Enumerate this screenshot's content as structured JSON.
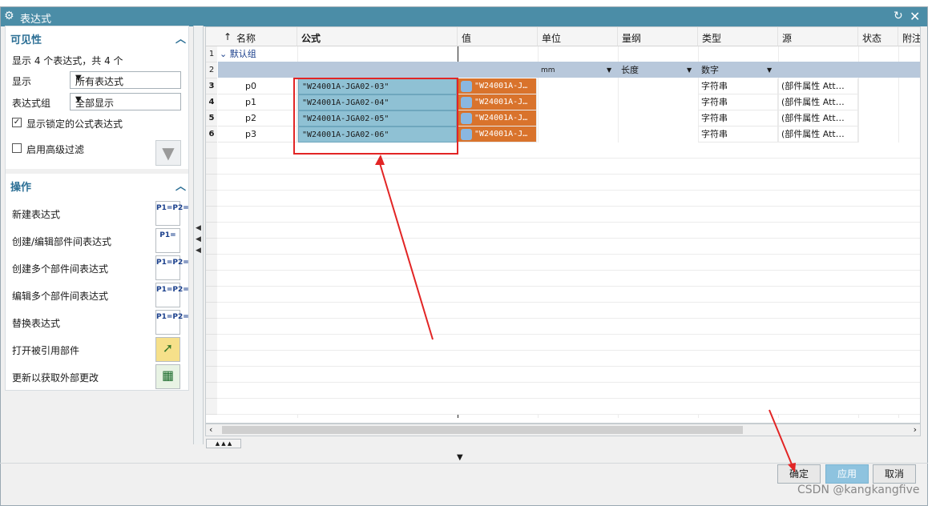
{
  "window": {
    "title": "表达式"
  },
  "visibility": {
    "header": "可见性",
    "count_text": "显示 4 个表达式，共 4 个",
    "show_label": "显示",
    "show_value": "所有表达式",
    "group_label": "表达式组",
    "group_value": "全部显示",
    "locked_checkbox": "显示锁定的公式表达式",
    "advanced_filter": "启用高级过滤"
  },
  "operations": {
    "header": "操作",
    "items": [
      {
        "label": "新建表达式",
        "icon": "new-expression-icon",
        "glyph": "P1=P2="
      },
      {
        "label": "创建/编辑部件间表达式",
        "icon": "interpart-expression-icon",
        "glyph": "P1="
      },
      {
        "label": "创建多个部件间表达式",
        "icon": "multi-interpart-icon",
        "glyph": "P1=P2="
      },
      {
        "label": "编辑多个部件间表达式",
        "icon": "edit-multi-interpart-icon",
        "glyph": "P1=P2="
      },
      {
        "label": "替换表达式",
        "icon": "replace-expression-icon",
        "glyph": "P1=P2="
      },
      {
        "label": "打开被引用部件",
        "icon": "open-folder-icon",
        "glyph": ""
      },
      {
        "label": "更新以获取外部更改",
        "icon": "update-external-icon",
        "glyph": ""
      }
    ]
  },
  "table": {
    "headers": {
      "sort": "↑",
      "name": "名称",
      "formula": "公式",
      "value": "值",
      "unit": "单位",
      "dimension": "量纲",
      "type": "类型",
      "source": "源",
      "status": "状态",
      "note": "附注"
    },
    "group_row": {
      "num": "1",
      "label": "默认组"
    },
    "filter_row": {
      "num": "2",
      "unit": "mm",
      "dimension": "长度",
      "type": "数字"
    },
    "rows": [
      {
        "num": "3",
        "name": "p0",
        "formula": "\"W24001A-JGA02-03\"",
        "value": "\"W24001A-J…",
        "type": "字符串",
        "source": "(部件属性 Att…"
      },
      {
        "num": "4",
        "name": "p1",
        "formula": "\"W24001A-JGA02-04\"",
        "value": "\"W24001A-J…",
        "type": "字符串",
        "source": "(部件属性 Att…"
      },
      {
        "num": "5",
        "name": "p2",
        "formula": "\"W24001A-JGA02-05\"",
        "value": "\"W24001A-J…",
        "type": "字符串",
        "source": "(部件属性 Att…"
      },
      {
        "num": "6",
        "name": "p3",
        "formula": "\"W24001A-JGA02-06\"",
        "value": "\"W24001A-J…",
        "type": "字符串",
        "source": "(部件属性 Att…"
      }
    ]
  },
  "buttons": {
    "ok": "确定",
    "apply": "应用",
    "cancel": "取消"
  },
  "watermark": "CSDN @kangkangfive",
  "colors": {
    "title_bar": "#4b8da7",
    "formula_cell": "#8fc1d4",
    "value_cell": "#d9732c",
    "annotation": "#e22525"
  }
}
